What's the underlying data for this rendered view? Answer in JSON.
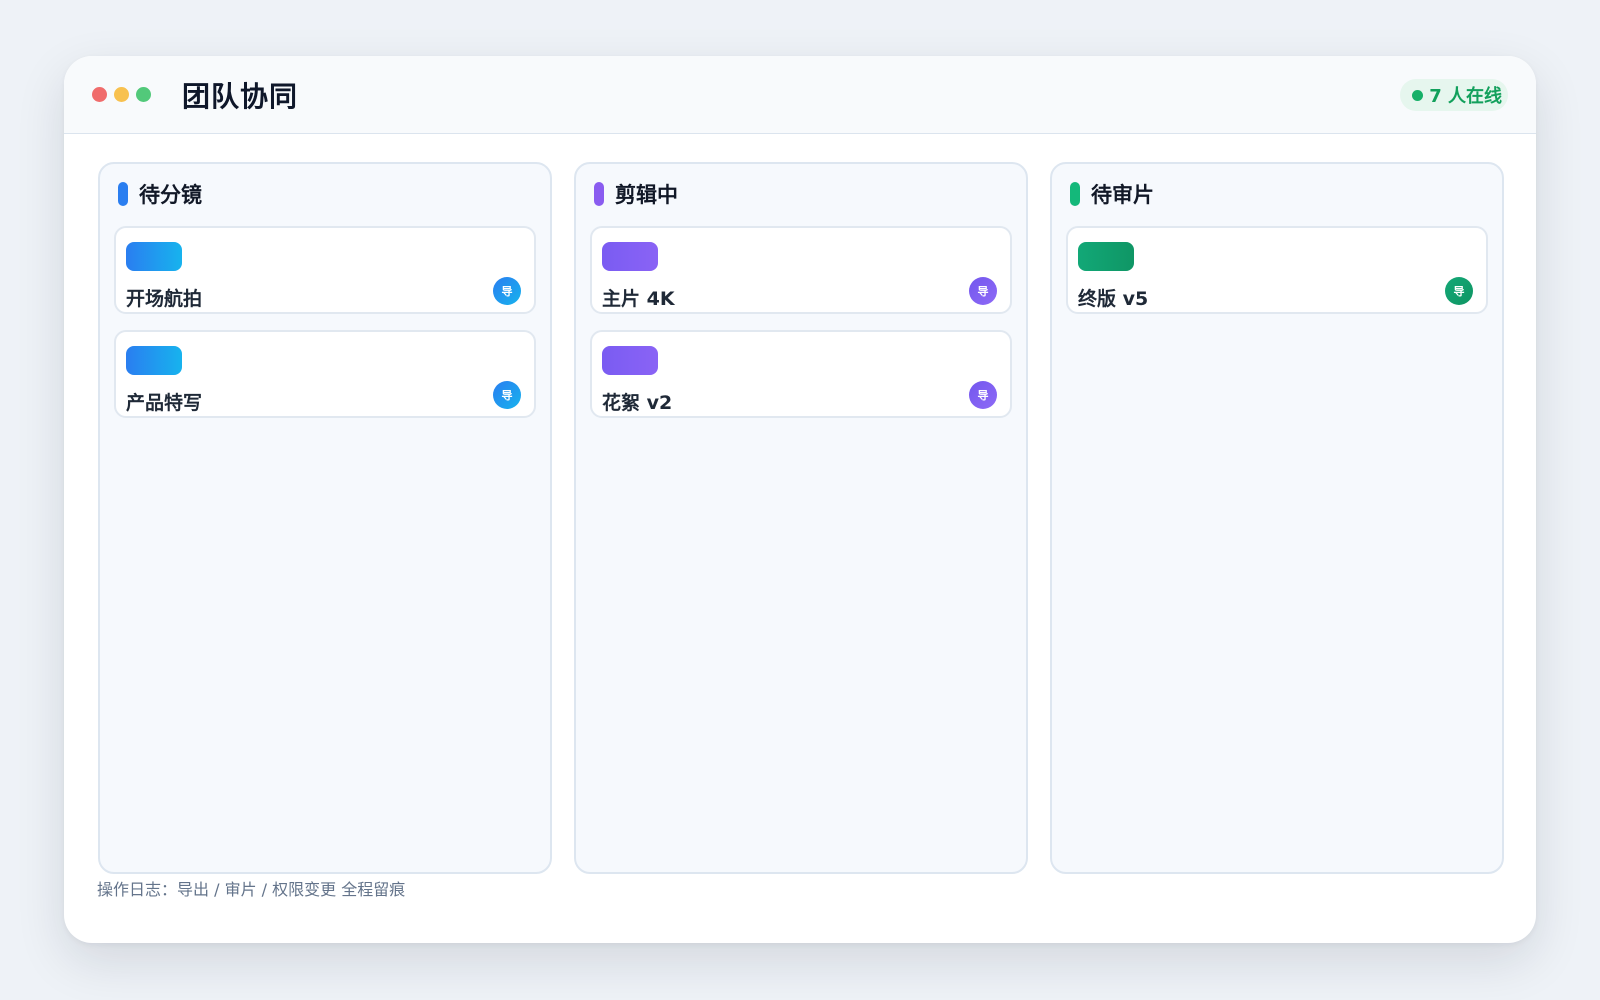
{
  "window": {
    "title": "团队协同",
    "online_label": "7 人在线"
  },
  "columns": [
    {
      "title": "待分镜",
      "accent": "#2a7ef0",
      "cards": [
        {
          "title": "开场航拍",
          "avatar": "导"
        },
        {
          "title": "产品特写",
          "avatar": "导"
        }
      ]
    },
    {
      "title": "剪辑中",
      "accent": "#8a5cf0",
      "cards": [
        {
          "title": "主片 4K",
          "avatar": "导"
        },
        {
          "title": "花絮 v2",
          "avatar": "导"
        }
      ]
    },
    {
      "title": "待审片",
      "accent": "#14b87a",
      "cards": [
        {
          "title": "终版 v5",
          "avatar": "导"
        }
      ]
    }
  ],
  "footer": {
    "log_text": "操作日志：导出 / 审片 / 权限变更 全程留痕"
  }
}
